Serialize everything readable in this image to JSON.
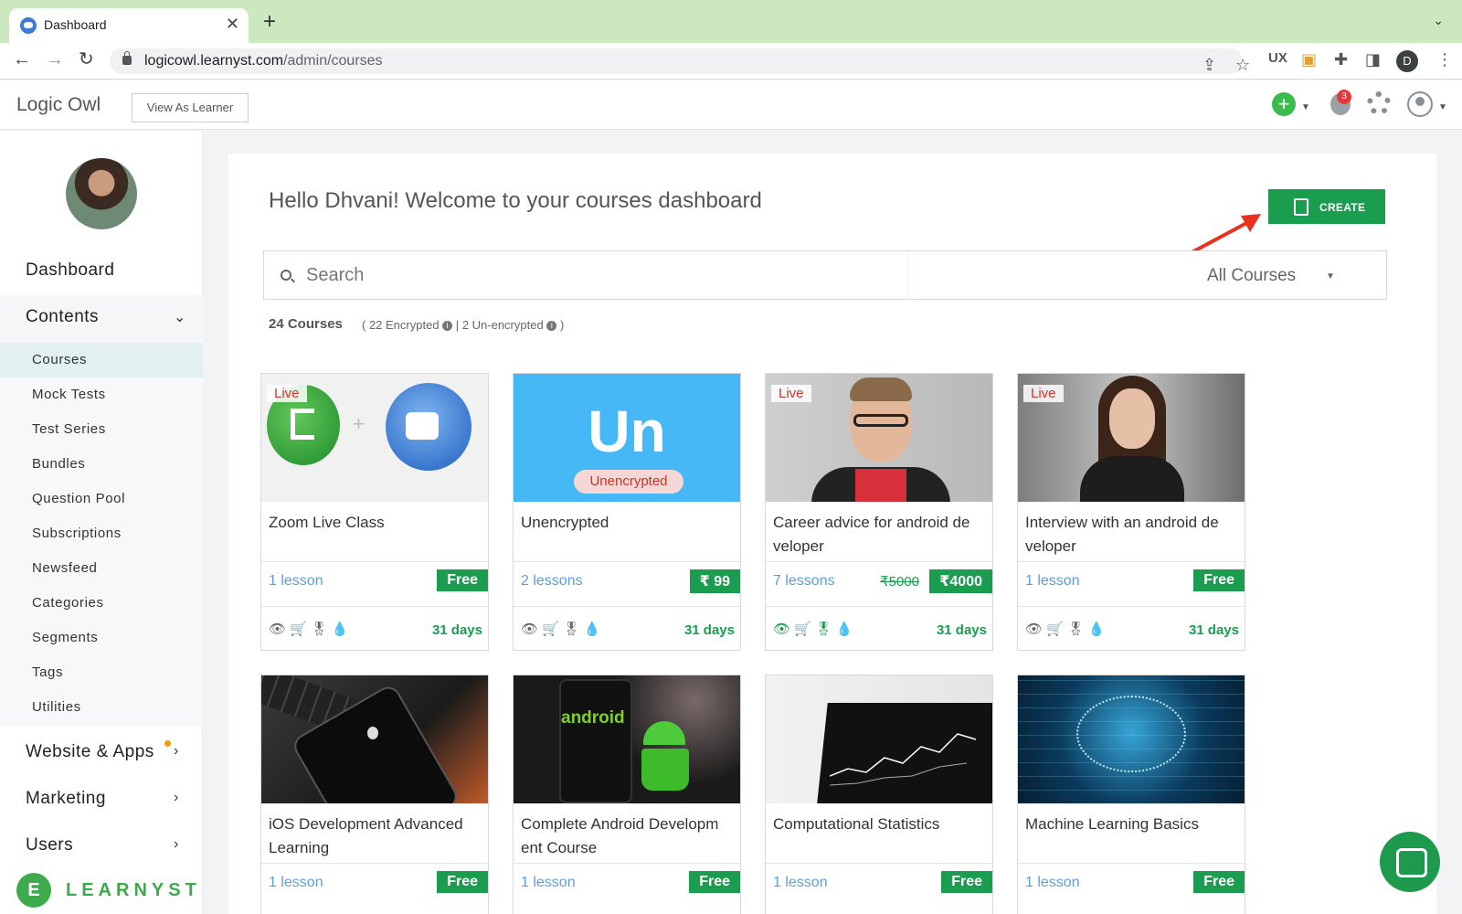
{
  "browser": {
    "tab_title": "Dashboard",
    "tab_close": "✕",
    "new_tab": "+",
    "tab_menu": "⌄",
    "url_host": "logicowl.learnyst.com",
    "url_path": "/admin/courses",
    "profile_letter": "D"
  },
  "header": {
    "brand": "Logic Owl",
    "view_as_learner": "View As Learner",
    "add_symbol": "+",
    "notification_count": "3"
  },
  "sidebar": {
    "dashboard": "Dashboard",
    "contents": "Contents",
    "sub_items": [
      "Courses",
      "Mock Tests",
      "Test Series",
      "Bundles",
      "Question Pool",
      "Subscriptions",
      "Newsfeed",
      "Categories",
      "Segments",
      "Tags",
      "Utilities"
    ],
    "website_apps": "Website & Apps",
    "marketing": "Marketing",
    "users": "Users",
    "logo_letter": "E",
    "logo_word": "LEARNYST"
  },
  "main": {
    "welcome": "Hello Dhvani! Welcome to your courses dashboard",
    "create_label": "CREATE",
    "search_placeholder": "Search",
    "filter_value": "All Courses",
    "course_count": "24 Courses",
    "encrypted_text": "( 22 Encrypted",
    "sep": "|",
    "unencrypted_text": "2 Un-encrypted",
    "close_paren": ")",
    "info": "i"
  },
  "icons_row": "👁🛒🎖💧",
  "courses": [
    {
      "title": "Zoom Live Class",
      "lessons": "1 lesson",
      "price": "Free",
      "old_price": "",
      "days": "31 days",
      "live": "Live",
      "icon": "zoom-class-image"
    },
    {
      "title": "Unencrypted",
      "lessons": "2 lessons",
      "price": "₹ 99",
      "old_price": "",
      "days": "31 days",
      "live": "",
      "icon": "unencrypted-image",
      "image_text": "Un",
      "image_badge": "Unencrypted"
    },
    {
      "title": "Career advice for android de veloper",
      "lessons": "7 lessons",
      "price": "₹4000",
      "old_price": "₹5000",
      "days": "31 days",
      "live": "Live",
      "icon": "career-advice-image"
    },
    {
      "title": "Interview with an android de veloper",
      "lessons": "1 lesson",
      "price": "Free",
      "old_price": "",
      "days": "31 days",
      "live": "Live",
      "icon": "interview-image"
    },
    {
      "title": "iOS Development Advanced Learning",
      "lessons": "1 lesson",
      "price": "Free",
      "icon": "ios-image"
    },
    {
      "title": "Complete Android Developm ent Course",
      "lessons": "1 lesson",
      "price": "Free",
      "icon": "android-image",
      "image_text": "android"
    },
    {
      "title": "Computational Statistics",
      "lessons": "1 lesson",
      "price": "Free",
      "icon": "statistics-image"
    },
    {
      "title": "Machine Learning Basics",
      "lessons": "1 lesson",
      "price": "Free",
      "icon": "machine-learning-image"
    }
  ],
  "colors": {
    "accent_green": "#1a9d4f",
    "link_blue": "#5d9ee0",
    "live_red": "#d0352f",
    "tabbar": "#cbe8c0"
  }
}
